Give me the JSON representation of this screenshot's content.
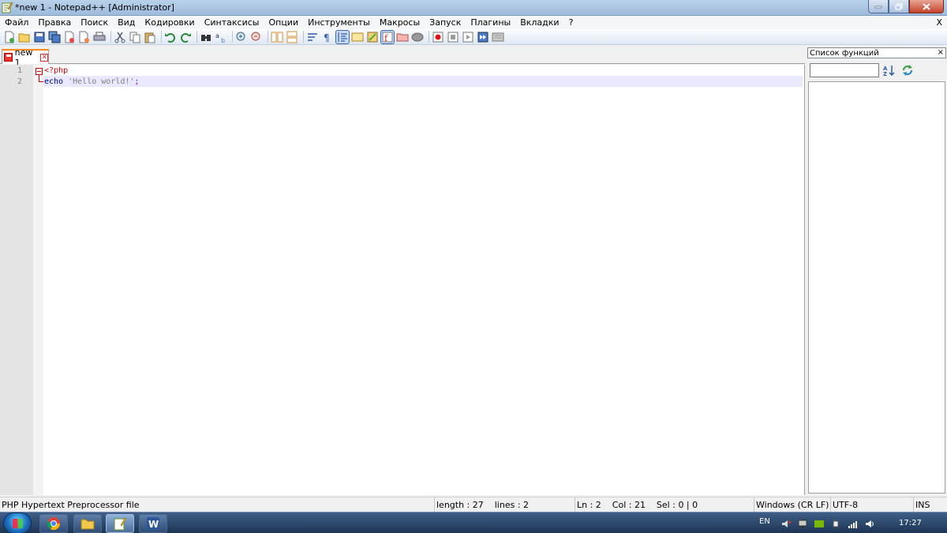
{
  "window": {
    "title": "*new 1 - Notepad++ [Administrator]"
  },
  "menu": {
    "items": [
      "Файл",
      "Правка",
      "Поиск",
      "Вид",
      "Кодировки",
      "Синтаксисы",
      "Опции",
      "Инструменты",
      "Макросы",
      "Запуск",
      "Плагины",
      "Вкладки",
      "?"
    ],
    "close": "X"
  },
  "toolbar": {
    "icons": [
      "new-file-icon",
      "open-file-icon",
      "save-icon",
      "save-all-icon",
      "close-icon",
      "close-all-icon",
      "print-icon",
      "cut-icon",
      "copy-icon",
      "paste-icon",
      "undo-icon",
      "redo-icon",
      "find-icon",
      "replace-icon",
      "zoom-in-icon",
      "zoom-out-icon",
      "sync-vertical-icon",
      "sync-horizontal-icon",
      "word-wrap-icon",
      "show-all-chars-icon",
      "indent-guide-icon",
      "udl-icon",
      "doc-map-icon",
      "function-list-icon",
      "folder-workspace-icon",
      "monitoring-icon",
      "record-macro-icon",
      "stop-macro-icon",
      "play-macro-icon",
      "run-macro-multiple-icon",
      "save-macro-icon"
    ]
  },
  "tabs": [
    {
      "label": "new 1",
      "close": "✕"
    }
  ],
  "editor": {
    "line_numbers": [
      "1",
      "2"
    ],
    "line1": {
      "tag": "<?php"
    },
    "line2": {
      "keyword": "echo",
      "space": " ",
      "string": "'Hello world!'",
      "semicolon": ";"
    }
  },
  "function_list": {
    "title": "Список функций",
    "close": "×",
    "search_value": ""
  },
  "statusbar": {
    "file_type": "PHP Hypertext Preprocessor file",
    "length": "length : 27    lines : 2",
    "position": "Ln : 2    Col : 21    Sel : 0 | 0",
    "eol": "Windows (CR LF)",
    "encoding": "UTF-8",
    "mode": "INS"
  },
  "taskbar": {
    "language": "EN",
    "time": "17:27"
  },
  "colors": {
    "php_tag": "#e00000",
    "keyword": "#00008b",
    "string": "#808080",
    "current_line": "#e8e8ff",
    "tab_accent": "#fa8a1d"
  }
}
